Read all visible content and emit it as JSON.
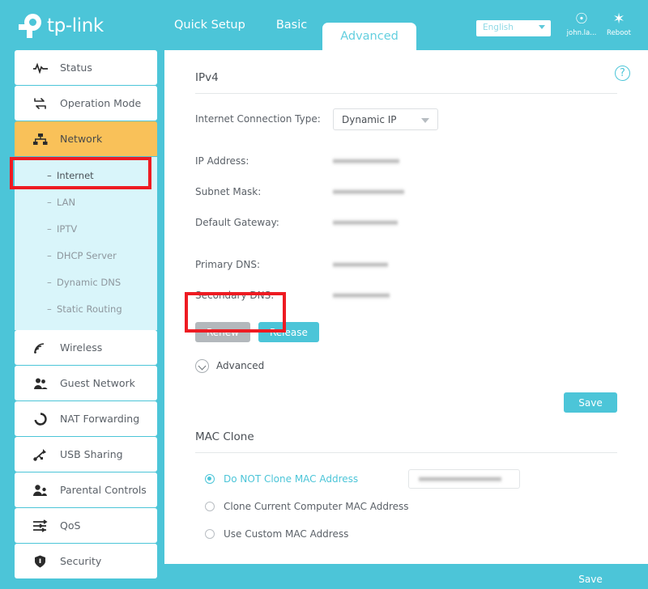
{
  "header": {
    "brand": "tp-link",
    "tabs": [
      {
        "label": "Quick Setup",
        "active": false
      },
      {
        "label": "Basic",
        "active": false
      },
      {
        "label": "Advanced",
        "active": true
      }
    ],
    "language": "English",
    "account_label": "john.la...",
    "account_icon": "user-location-icon",
    "reboot_label": "Reboot",
    "reboot_icon": "reboot-icon"
  },
  "sidebar": {
    "items": [
      {
        "label": "Status",
        "icon": "pulse-icon",
        "active": false
      },
      {
        "label": "Operation Mode",
        "icon": "swap-arrows-icon",
        "active": false
      },
      {
        "label": "Network",
        "icon": "sitemap-icon",
        "active": true
      }
    ],
    "submenu": [
      {
        "label": "Internet",
        "current": true
      },
      {
        "label": "LAN",
        "current": false
      },
      {
        "label": "IPTV",
        "current": false
      },
      {
        "label": "DHCP Server",
        "current": false
      },
      {
        "label": "Dynamic DNS",
        "current": false
      },
      {
        "label": "Static Routing",
        "current": false
      }
    ],
    "items_after": [
      {
        "label": "Wireless",
        "icon": "wifi-icon"
      },
      {
        "label": "Guest Network",
        "icon": "users-icon"
      },
      {
        "label": "NAT Forwarding",
        "icon": "refresh-circle-icon"
      },
      {
        "label": "USB Sharing",
        "icon": "usb-icon"
      },
      {
        "label": "Parental Controls",
        "icon": "parental-icon"
      },
      {
        "label": "QoS",
        "icon": "sliders-icon"
      },
      {
        "label": "Security",
        "icon": "shield-icon"
      }
    ]
  },
  "ipv4": {
    "title": "IPv4",
    "help_icon": "question-mark-icon",
    "connection_type_label": "Internet Connection Type:",
    "connection_type_value": "Dynamic IP",
    "fields": [
      {
        "label": "IP Address:",
        "value": ""
      },
      {
        "label": "Subnet Mask:",
        "value": ""
      },
      {
        "label": "Default Gateway:",
        "value": ""
      }
    ],
    "dns_fields": [
      {
        "label": "Primary DNS:",
        "value": ""
      },
      {
        "label": "Secondary DNS:",
        "value": ""
      }
    ],
    "renew_label": "Renew",
    "release_label": "Release",
    "advanced_label": "Advanced",
    "advanced_icon": "chevron-down-circle-icon",
    "save_label": "Save"
  },
  "mac_clone": {
    "title": "MAC Clone",
    "options": [
      {
        "label": "Do NOT Clone MAC Address",
        "selected": true
      },
      {
        "label": "Clone Current Computer MAC Address",
        "selected": false
      },
      {
        "label": "Use Custom MAC Address",
        "selected": false
      }
    ],
    "mac_value": "",
    "save_label": "Save"
  },
  "colors": {
    "brand_teal": "#4cc5d8",
    "active_orange": "#f9c159",
    "submenu_bg": "#d9f5fa",
    "annotation_red": "#ee1b22",
    "disabled_gray": "#b3b8bc"
  }
}
